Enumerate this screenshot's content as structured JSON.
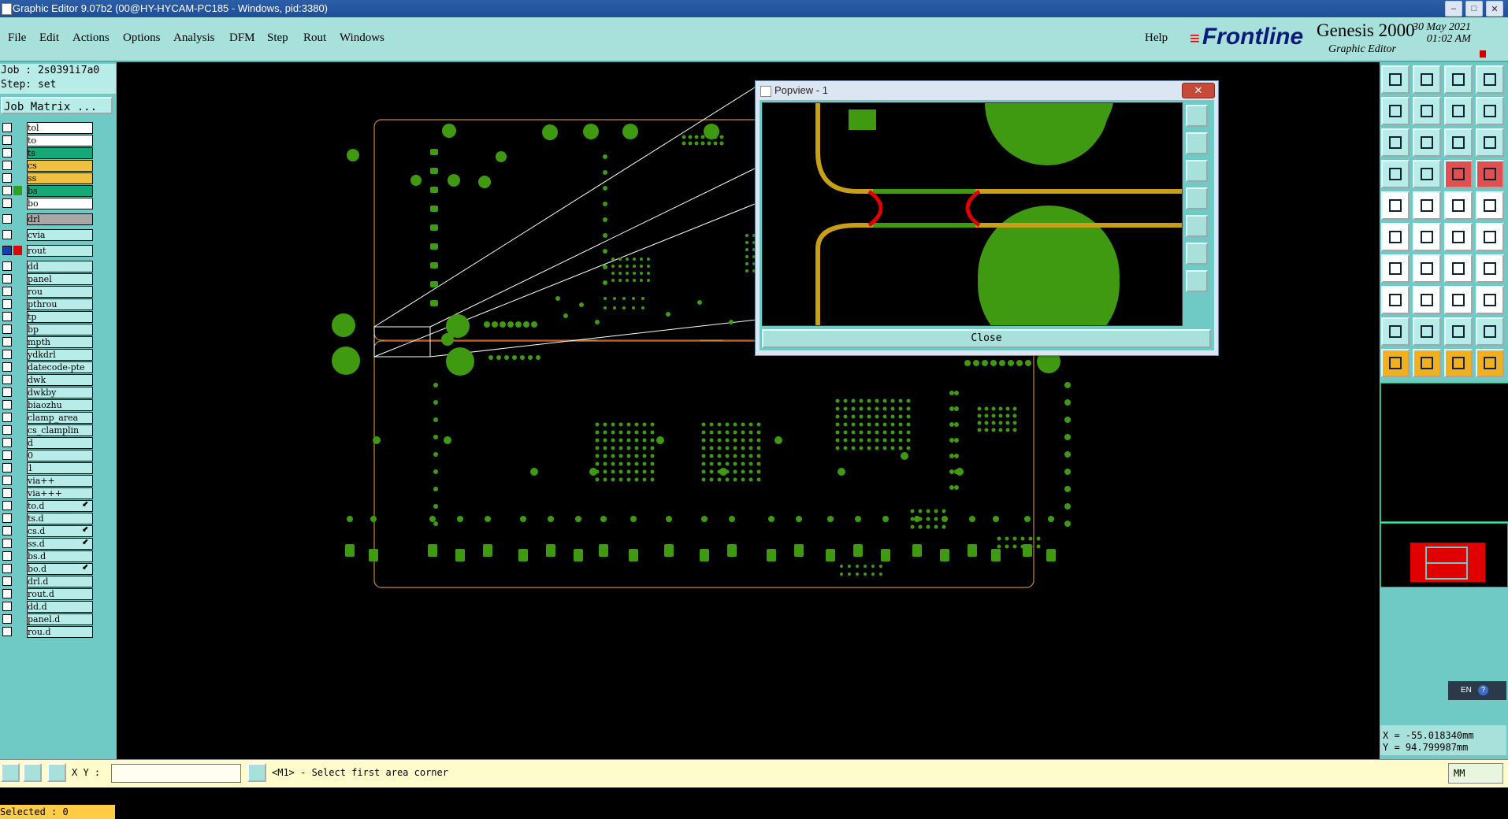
{
  "window": {
    "title": "Graphic Editor 9.07b2 (00@HY-HYCAM-PC185 - Windows, pid:3380)",
    "controls": [
      "–",
      "□",
      "✕"
    ]
  },
  "menu": {
    "items": [
      "File",
      "Edit",
      "Actions",
      "Options",
      "Analysis",
      "DFM",
      "Step",
      "Rout",
      "Windows"
    ],
    "help": "Help"
  },
  "brand": {
    "logo": "Frontline",
    "product": "Genesis 2000",
    "subtitle": "Graphic Editor",
    "date": "30 May 2021",
    "time": "01:02 AM"
  },
  "job": {
    "job_line": "Job : 2s0391i7a0",
    "step_line": "Step: set",
    "matrix_button": "Job Matrix ..."
  },
  "layers": [
    {
      "name": "tol",
      "color": "#ffffff",
      "fill": "#ffffff"
    },
    {
      "name": "to",
      "color": "#ffffff",
      "fill": "#ffffff"
    },
    {
      "name": "ts",
      "color": "#18a878",
      "fill": "#18a878"
    },
    {
      "name": "cs",
      "color": "#f0c040",
      "fill": "#f0c040"
    },
    {
      "name": "ss",
      "color": "#f0c040",
      "fill": "#f0c040"
    },
    {
      "name": "bs",
      "color": "#18a878",
      "fill": "#18a878",
      "swatch": "#2ea020"
    },
    {
      "name": "bo",
      "color": "#ffffff",
      "fill": "#ffffff"
    },
    {
      "name": "drl",
      "color": "#a8a8a8",
      "fill": "#a8a8a8"
    },
    {
      "name": "cvia",
      "color": "#b8ece8",
      "fill": "#b8ece8"
    },
    {
      "name": "rout",
      "color": "#b8ece8",
      "fill": "#b8ece8",
      "swatch": "#e00000",
      "checked": true
    },
    {
      "name": "dd",
      "color": "#b8ece8",
      "fill": "#b8ece8"
    },
    {
      "name": "panel",
      "color": "#b8ece8",
      "fill": "#b8ece8"
    },
    {
      "name": "rou",
      "color": "#b8ece8",
      "fill": "#b8ece8"
    },
    {
      "name": "pthrou",
      "color": "#b8ece8",
      "fill": "#b8ece8"
    },
    {
      "name": "tp",
      "color": "#b8ece8",
      "fill": "#b8ece8"
    },
    {
      "name": "bp",
      "color": "#b8ece8",
      "fill": "#b8ece8"
    },
    {
      "name": "mpth",
      "color": "#b8ece8",
      "fill": "#b8ece8"
    },
    {
      "name": "ydkdrl",
      "color": "#b8ece8",
      "fill": "#b8ece8"
    },
    {
      "name": "datecode-pte",
      "color": "#b8ece8",
      "fill": "#b8ece8"
    },
    {
      "name": "dwk",
      "color": "#b8ece8",
      "fill": "#b8ece8"
    },
    {
      "name": "dwkby",
      "color": "#b8ece8",
      "fill": "#b8ece8"
    },
    {
      "name": "biaozhu",
      "color": "#b8ece8",
      "fill": "#b8ece8"
    },
    {
      "name": "clamp_area",
      "color": "#b8ece8",
      "fill": "#b8ece8"
    },
    {
      "name": "cs_clamplin",
      "color": "#b8ece8",
      "fill": "#b8ece8"
    },
    {
      "name": "d",
      "color": "#b8ece8",
      "fill": "#b8ece8"
    },
    {
      "name": "0",
      "color": "#b8ece8",
      "fill": "#b8ece8"
    },
    {
      "name": "1",
      "color": "#b8ece8",
      "fill": "#b8ece8"
    },
    {
      "name": "via++",
      "color": "#b8ece8",
      "fill": "#b8ece8"
    },
    {
      "name": "via+++",
      "color": "#b8ece8",
      "fill": "#b8ece8"
    },
    {
      "name": "to.d",
      "color": "#b8ece8",
      "fill": "#b8ece8",
      "marker": "⬋"
    },
    {
      "name": "ts.d",
      "color": "#b8ece8",
      "fill": "#b8ece8"
    },
    {
      "name": "cs.d",
      "color": "#b8ece8",
      "fill": "#b8ece8",
      "marker": "⬋"
    },
    {
      "name": "ss.d",
      "color": "#b8ece8",
      "fill": "#b8ece8",
      "marker": "⬋"
    },
    {
      "name": "bs.d",
      "color": "#b8ece8",
      "fill": "#b8ece8"
    },
    {
      "name": "bo.d",
      "color": "#b8ece8",
      "fill": "#b8ece8",
      "marker": "⬋"
    },
    {
      "name": "drl.d",
      "color": "#b8ece8",
      "fill": "#b8ece8"
    },
    {
      "name": "rout.d",
      "color": "#b8ece8",
      "fill": "#b8ece8"
    },
    {
      "name": "dd.d",
      "color": "#b8ece8",
      "fill": "#b8ece8"
    },
    {
      "name": "panel.d",
      "color": "#b8ece8",
      "fill": "#b8ece8"
    },
    {
      "name": "rou.d",
      "color": "#b8ece8",
      "fill": "#b8ece8"
    }
  ],
  "selected_label": "Selected : 0",
  "popview": {
    "title": "Popview - 1",
    "close_button": "Close",
    "close_x": "✕"
  },
  "coordinates": {
    "x": "X = -55.018340mm",
    "y": "Y = 94.799987mm"
  },
  "input_indicator": {
    "language": "EN",
    "help": "?"
  },
  "status": {
    "xy_label": "X Y :",
    "xy_value": "",
    "message": "<M1> - Select first area corner",
    "units": "MM"
  },
  "colors": {
    "pcb_green": "#3f9a12",
    "outline": "#c88a2a",
    "accent": "#a8e0dc",
    "panel": "#6fc9c4"
  }
}
